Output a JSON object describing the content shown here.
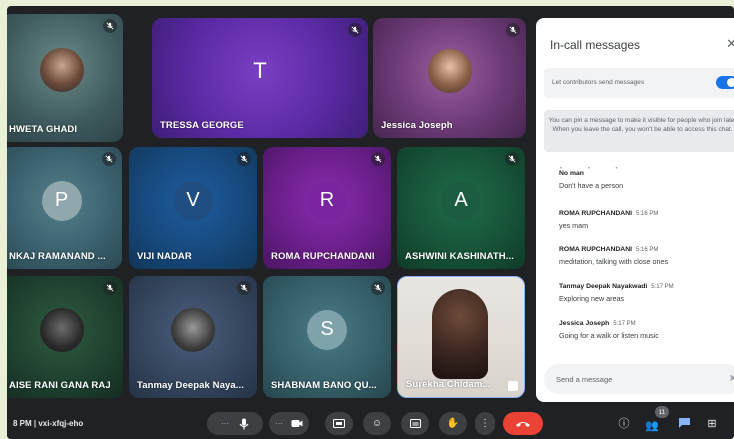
{
  "participants": [
    {
      "name": "HWETA GHADI"
    },
    {
      "name": "TRESSA GEORGE",
      "letter": "T"
    },
    {
      "name": "Jessica Joseph"
    },
    {
      "name": "NKAJ RAMANAND ...",
      "letter": "P"
    },
    {
      "name": "VIJI NADAR",
      "letter": "V"
    },
    {
      "name": "ROMA RUPCHANDANI",
      "letter": "R"
    },
    {
      "name": "ASHWINI KASHINATH...",
      "letter": "A"
    },
    {
      "name": "AISE RANI GANA RAJ"
    },
    {
      "name": "Tanmay Deepak Naya..."
    },
    {
      "name": "SHABNAM BANO QU...",
      "letter": "S"
    },
    {
      "name": "Surekha Chidam..."
    }
  ],
  "panel": {
    "title": "In-call messages",
    "toggle_label": "Let contributors send messages",
    "info": "You can pin a message to make it visible for people who join late. When you leave the call, you won't be able to access this chat.",
    "messages": [
      {
        "sender": "No man",
        "time": "",
        "text": "Don't have a person"
      },
      {
        "sender": "ROMA RUPCHANDANI",
        "time": "5:16 PM",
        "text": "yes mam"
      },
      {
        "sender": "ROMA RUPCHANDANI",
        "time": "5:16 PM",
        "text": "meditation, talking with close ones"
      },
      {
        "sender": "Tanmay Deepak Nayakwadi",
        "time": "5:17 PM",
        "text": "Exploring new areas"
      },
      {
        "sender": "Jessica Joseph",
        "time": "5:17 PM",
        "text": "Going for a walk or listen music"
      }
    ],
    "send_placeholder": "Send a message"
  },
  "bottombar": {
    "meeting_info": "8 PM  |  vxi-xfqj-eho",
    "participants_count": "11"
  },
  "colors": {
    "accent": "#1a73e8",
    "end_call": "#ea4335"
  }
}
